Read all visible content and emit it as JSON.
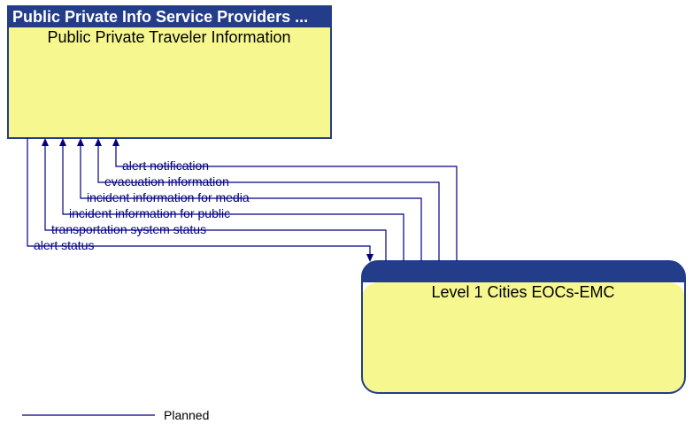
{
  "top_box": {
    "header": "Public Private Info Service Providers ...",
    "body": "Public Private Traveler Information"
  },
  "bottom_box": {
    "header": "",
    "body": "Level 1 Cities EOCs-EMC"
  },
  "flows": {
    "f1": "alert notification",
    "f2": "evacuation information",
    "f3": "incident information for media",
    "f4": "incident information for public",
    "f5": "transportation system status",
    "f6": "alert status"
  },
  "legend": {
    "planned": "Planned"
  },
  "chart_data": {
    "type": "diagram",
    "nodes": [
      {
        "id": "ppti",
        "stakeholder": "Public Private Info Service Providers ...",
        "element": "Public Private Traveler Information"
      },
      {
        "id": "eoc",
        "stakeholder": "",
        "element": "Level 1 Cities EOCs-EMC"
      }
    ],
    "edges": [
      {
        "from": "eoc",
        "to": "ppti",
        "label": "alert notification",
        "status": "Planned"
      },
      {
        "from": "eoc",
        "to": "ppti",
        "label": "evacuation information",
        "status": "Planned"
      },
      {
        "from": "eoc",
        "to": "ppti",
        "label": "incident information for media",
        "status": "Planned"
      },
      {
        "from": "eoc",
        "to": "ppti",
        "label": "incident information for public",
        "status": "Planned"
      },
      {
        "from": "eoc",
        "to": "ppti",
        "label": "transportation system status",
        "status": "Planned"
      },
      {
        "from": "ppti",
        "to": "eoc",
        "label": "alert status",
        "status": "Planned"
      }
    ],
    "legend": [
      "Planned"
    ]
  }
}
